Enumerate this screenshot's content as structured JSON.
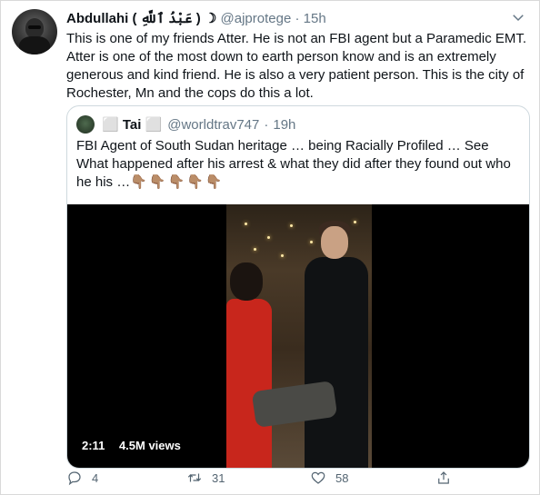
{
  "tweet": {
    "author_name": "Abdullahi ( عَبْدُ ٱللَّهِ ) ☽",
    "handle": "@ajprotege",
    "separator": "·",
    "time": "15h",
    "text": "This is one of my friends Atter. He is not an FBI agent  but a Paramedic EMT. Atter is one of the most down to earth person know and is an extremely generous and kind friend. He is also a very patient person. This is the city of Rochester, Mn and the cops do this a lot."
  },
  "quoted_tweet": {
    "author_name": "⬜ Tai ⬜",
    "handle": "@worldtrav747",
    "separator": "·",
    "time": "19h",
    "text": "FBI Agent of South Sudan heritage … being Racially Profiled … See What happened after his arrest & what they did after they found out who he his …",
    "emojis": "👇🏽👇🏽👇🏽👇🏽👇🏽",
    "video": {
      "duration": "2:11",
      "views": "4.5M views"
    }
  },
  "actions": {
    "reply_count": "4",
    "retweet_count": "31",
    "like_count": "58"
  },
  "icons": {
    "menu": "chevron-down-icon",
    "reply": "reply-icon",
    "retweet": "retweet-icon",
    "like": "heart-icon",
    "share": "share-icon"
  },
  "colors": {
    "secondary_text": "#657786",
    "border": "#cfd9de"
  }
}
